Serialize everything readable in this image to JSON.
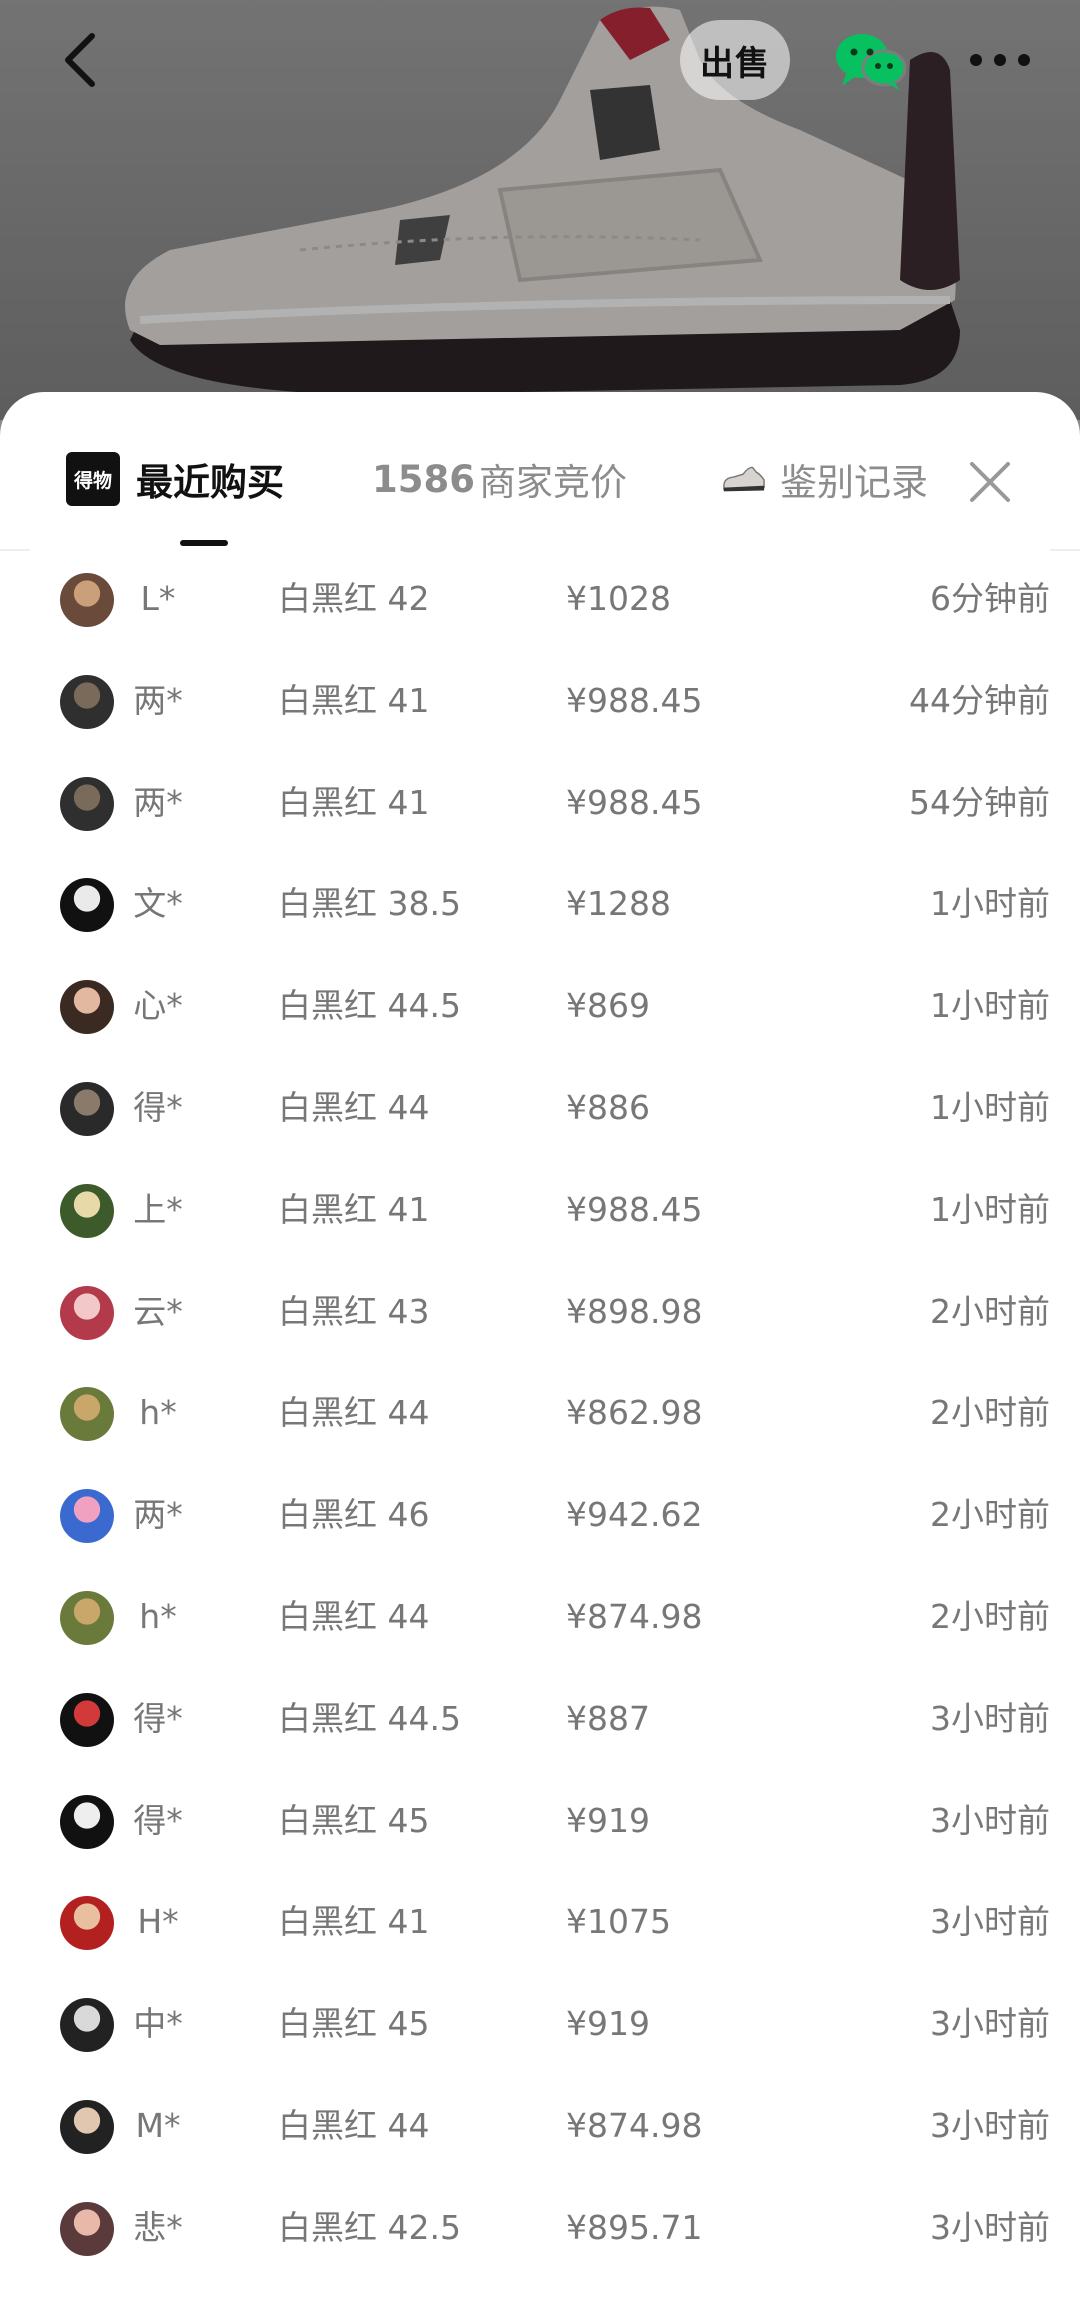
{
  "header": {
    "sell_label": "出售",
    "icons": [
      "back-arrow-icon",
      "wechat-icon",
      "more-icon"
    ]
  },
  "tabs": [
    {
      "logo_text": "得物",
      "label": "最近购买",
      "active": true
    },
    {
      "count": "1586",
      "label": "商家竞价"
    },
    {
      "label": "鉴别记录"
    }
  ],
  "colors": {
    "active_tab": "#111111",
    "inactive_tab": "#8c8c8c",
    "row_text": "#777777"
  },
  "records": [
    {
      "user": "L*",
      "item": "白黑红 42",
      "price": "¥1028",
      "time": "6分钟前"
    },
    {
      "user": "两*",
      "item": "白黑红 41",
      "price": "¥988.45",
      "time": "44分钟前"
    },
    {
      "user": "两*",
      "item": "白黑红 41",
      "price": "¥988.45",
      "time": "54分钟前"
    },
    {
      "user": "文*",
      "item": "白黑红 38.5",
      "price": "¥1288",
      "time": "1小时前"
    },
    {
      "user": "心*",
      "item": "白黑红 44.5",
      "price": "¥869",
      "time": "1小时前"
    },
    {
      "user": "得*",
      "item": "白黑红 44",
      "price": "¥886",
      "time": "1小时前"
    },
    {
      "user": "上*",
      "item": "白黑红 41",
      "price": "¥988.45",
      "time": "1小时前"
    },
    {
      "user": "云*",
      "item": "白黑红 43",
      "price": "¥898.98",
      "time": "2小时前"
    },
    {
      "user": "h*",
      "item": "白黑红 44",
      "price": "¥862.98",
      "time": "2小时前"
    },
    {
      "user": "两*",
      "item": "白黑红 46",
      "price": "¥942.62",
      "time": "2小时前"
    },
    {
      "user": "h*",
      "item": "白黑红 44",
      "price": "¥874.98",
      "time": "2小时前"
    },
    {
      "user": "得*",
      "item": "白黑红 44.5",
      "price": "¥887",
      "time": "3小时前"
    },
    {
      "user": "得*",
      "item": "白黑红 45",
      "price": "¥919",
      "time": "3小时前"
    },
    {
      "user": "H*",
      "item": "白黑红 41",
      "price": "¥1075",
      "time": "3小时前"
    },
    {
      "user": "中*",
      "item": "白黑红 45",
      "price": "¥919",
      "time": "3小时前"
    },
    {
      "user": "M*",
      "item": "白黑红 44",
      "price": "¥874.98",
      "time": "3小时前"
    },
    {
      "user": "悲*",
      "item": "白黑红 42.5",
      "price": "¥895.71",
      "time": "3小时前"
    }
  ]
}
